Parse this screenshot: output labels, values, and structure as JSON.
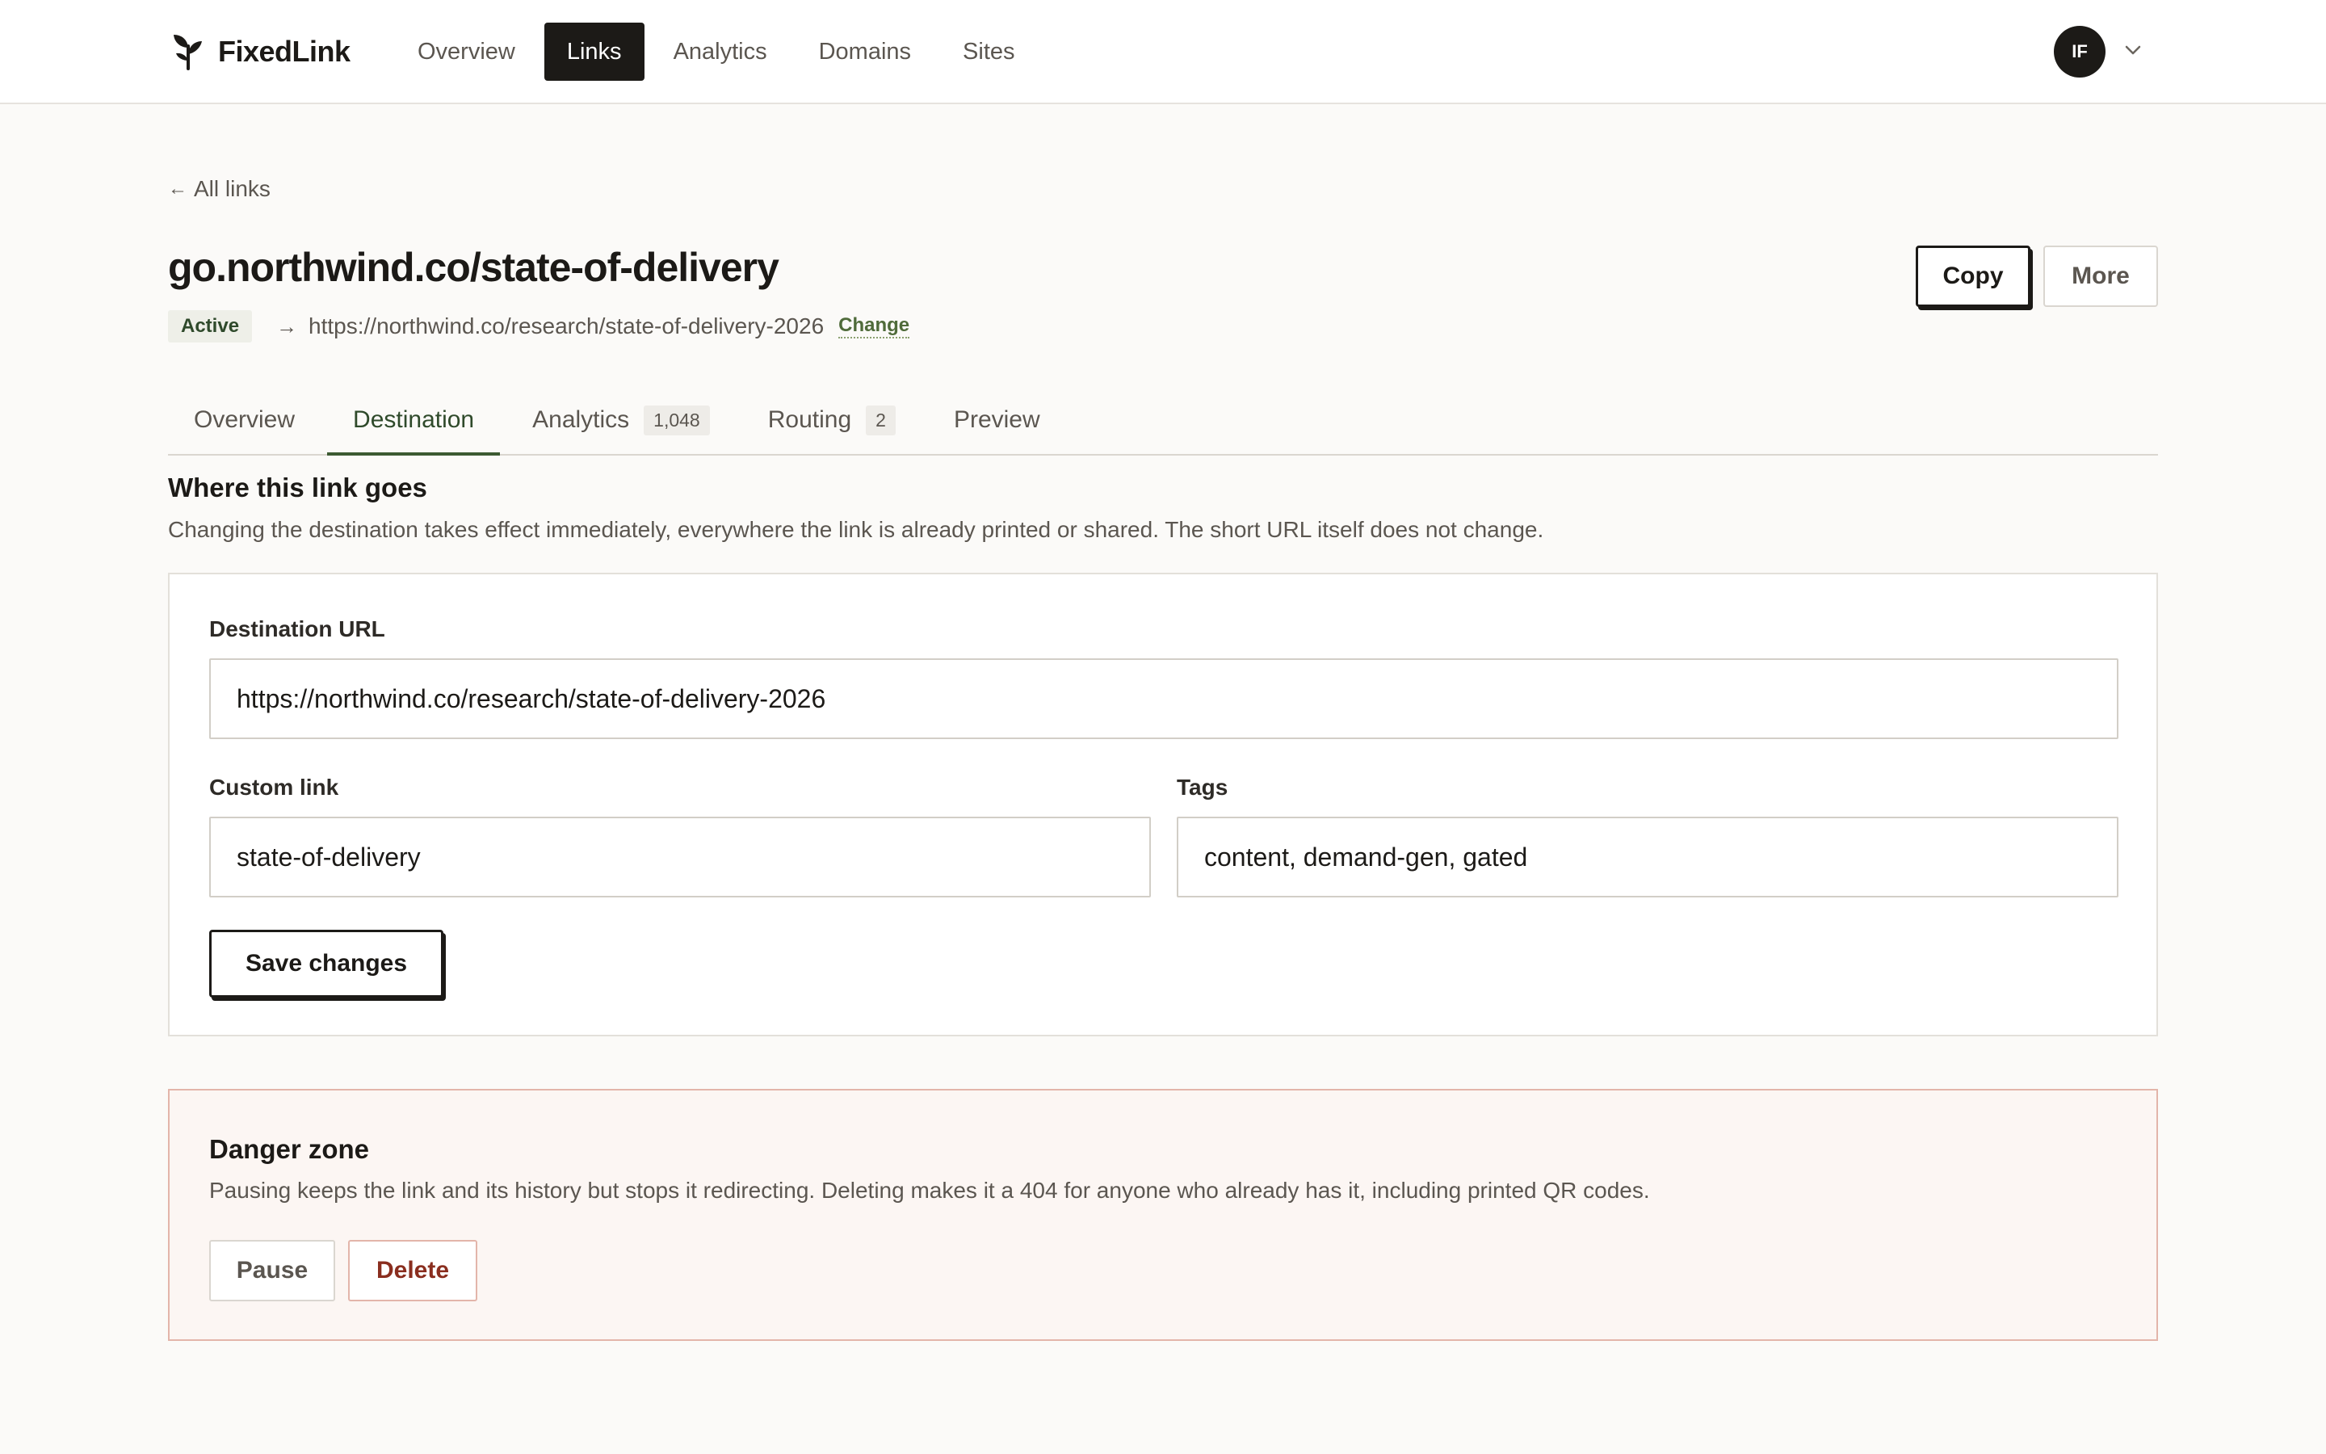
{
  "app": {
    "brand": "FixedLink",
    "logo_icon": "sprout-icon"
  },
  "nav": {
    "items": [
      {
        "label": "Overview",
        "active": false
      },
      {
        "label": "Links",
        "active": true
      },
      {
        "label": "Analytics",
        "active": false
      },
      {
        "label": "Domains",
        "active": false
      },
      {
        "label": "Sites",
        "active": false
      }
    ],
    "avatar_initials": "IF",
    "avatar_caret_icon": "chevron-down-icon"
  },
  "header": {
    "back_arrow": "←",
    "back_label": "All links",
    "title": "go.northwind.co/state-of-delivery",
    "status": "Active",
    "dest_arrow": "→",
    "destination": "https://northwind.co/research/state-of-delivery-2026",
    "change_label": "Change",
    "copy_label": "Copy",
    "more_label": "More"
  },
  "tabs": [
    {
      "label": "Overview",
      "count": null,
      "active": false
    },
    {
      "label": "Destination",
      "count": null,
      "active": true
    },
    {
      "label": "Analytics",
      "count": "1,048",
      "active": false
    },
    {
      "label": "Routing",
      "count": "2",
      "active": false
    },
    {
      "label": "Preview",
      "count": null,
      "active": false
    }
  ],
  "section": {
    "title": "Where this link goes",
    "description": "Changing the destination takes effect immediately, everywhere the link is already printed or shared. The short URL itself does not change."
  },
  "form": {
    "destination_label": "Destination URL",
    "destination_value": "https://northwind.co/research/state-of-delivery-2026",
    "custom_label": "Custom link",
    "custom_value": "state-of-delivery",
    "tags_label": "Tags",
    "tags_value": "content, demand-gen, gated",
    "save_label": "Save changes"
  },
  "danger": {
    "title": "Danger zone",
    "description": "Pausing keeps the link and its history but stops it redirecting. Deleting makes it a 404 for anyone who already has it, including printed QR codes.",
    "pause_label": "Pause",
    "delete_label": "Delete"
  },
  "colors": {
    "accent": "#3c5a32",
    "ink": "#1c1a17",
    "danger": "#8a2e1f",
    "background": "#fbfaf8"
  }
}
